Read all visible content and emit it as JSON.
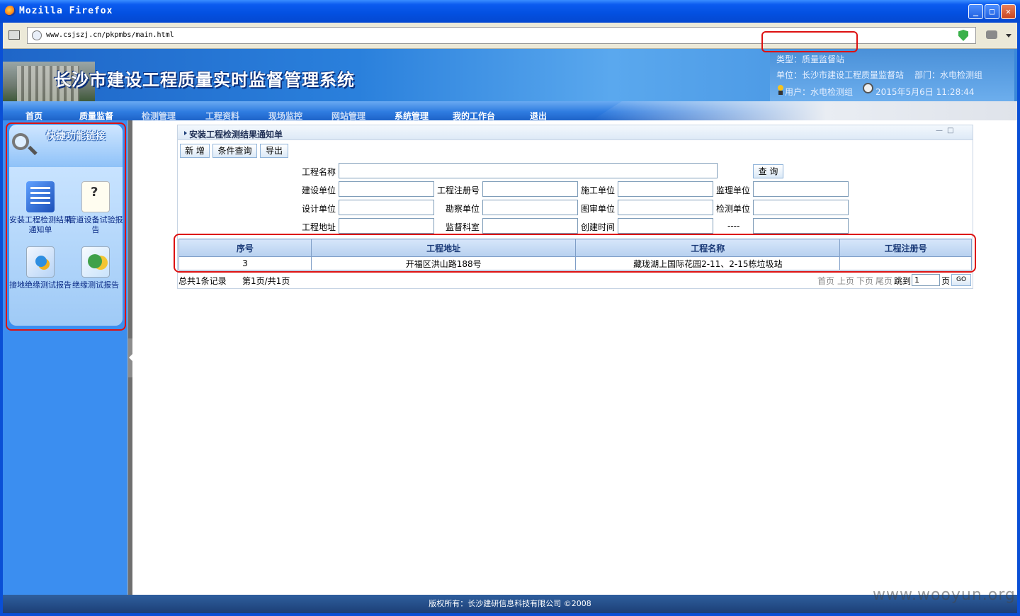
{
  "window": {
    "title": "Mozilla Firefox",
    "url": "www.csjszj.cn/pkpmbs/main.html"
  },
  "header": {
    "system_name": "长沙市建设工程质量实时监督管理系统",
    "type_line": "类型：质量监督站",
    "unit_line": "单位：长沙市建设工程质量监督站",
    "dept_line": "部门：水电检测组",
    "user_line": "用户：水电检测组",
    "datetime": "2015年5月6日 11:28:44"
  },
  "nav": {
    "items": [
      {
        "label": "首页"
      },
      {
        "label": "质量监督"
      },
      {
        "label": "检测管理"
      },
      {
        "label": "工程资料"
      },
      {
        "label": "现场监控"
      },
      {
        "label": "网站管理"
      },
      {
        "label": "系统管理"
      },
      {
        "label": "我的工作台"
      },
      {
        "label": "退出"
      }
    ]
  },
  "sidebar": {
    "title": "快捷功能链接",
    "items": [
      {
        "label": "安装工程检测结果通知单",
        "icon": "report-doc-icon"
      },
      {
        "label": "管道设备试验报告",
        "icon": "pipe-report-icon"
      },
      {
        "label": "接地绝缘测试报告",
        "icon": "grounding-icon"
      },
      {
        "label": "绝缘测试报告",
        "icon": "insulation-icon"
      }
    ]
  },
  "panel": {
    "title": "安装工程检测结果通知单",
    "min": "—",
    "max": "□",
    "toolbar": {
      "add": "新 增",
      "query": "条件查询",
      "export": "导出"
    },
    "search_button": "查 询",
    "fields": {
      "project_name": "工程名称",
      "build_unit": "建设单位",
      "reg_no": "工程注册号",
      "construct_unit": "施工单位",
      "supervise_unit": "监理单位",
      "design_unit": "设计单位",
      "survey_unit": "勘察单位",
      "drawing_review_unit": "图审单位",
      "test_unit": "检测单位",
      "address": "工程地址",
      "supervise_section": "监督科室",
      "create_time": "创建时间",
      "dash": "----"
    },
    "table": {
      "headers": [
        "序号",
        "工程地址",
        "工程名称",
        "工程注册号"
      ],
      "rows": [
        [
          "3",
          "开福区洪山路188号",
          "藏珑湖上国际花园2-11、2-15栋垃圾站",
          ""
        ]
      ]
    },
    "pager": {
      "total": "总共1条记录",
      "page_info": "第1页/共1页",
      "first": "首页",
      "prev": "上页",
      "next": "下页",
      "last": "尾页",
      "jump": "跳到",
      "page_value": "1",
      "page_unit": "页",
      "go": "GO"
    }
  },
  "footer": {
    "text": "版权所有：长沙建研信息科技有限公司 ©2008"
  },
  "watermark": "www.wooyun.org"
}
